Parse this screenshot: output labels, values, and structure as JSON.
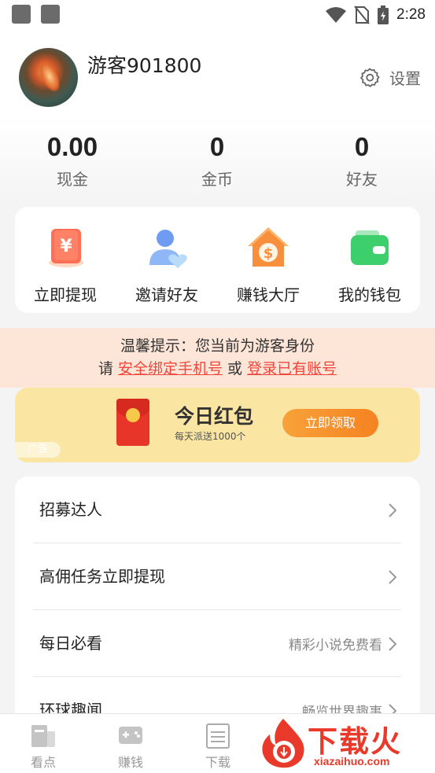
{
  "status_bar": {
    "time": "2:28"
  },
  "profile": {
    "username": "游客901800",
    "settings_label": "设置"
  },
  "stats": [
    {
      "value": "0.00",
      "label": "现金"
    },
    {
      "value": "0",
      "label": "金币"
    },
    {
      "value": "0",
      "label": "好友"
    }
  ],
  "actions": [
    {
      "label": "立即提现",
      "icon": "withdraw-yuan-icon"
    },
    {
      "label": "邀请好友",
      "icon": "invite-friend-icon"
    },
    {
      "label": "赚钱大厅",
      "icon": "money-house-icon"
    },
    {
      "label": "我的钱包",
      "icon": "wallet-icon"
    }
  ],
  "notice": {
    "line1": "温馨提示：您当前为游客身份",
    "prefix": "请",
    "bind_phone": "安全绑定手机号",
    "middle": "或",
    "login": "登录已有账号"
  },
  "ad": {
    "title": "今日红包",
    "subtitle": "每天派送1000个",
    "button": "立即领取",
    "tag": "广告"
  },
  "menu": [
    {
      "label": "招募达人",
      "hint": ""
    },
    {
      "label": "高佣任务立即提现",
      "hint": ""
    },
    {
      "label": "每日必看",
      "hint": "精彩小说免费看"
    },
    {
      "label": "环球趣闻",
      "hint": "畅览世界趣事"
    }
  ],
  "bottom_nav": [
    {
      "label": "看点",
      "icon": "news-icon"
    },
    {
      "label": "赚钱",
      "icon": "gamepad-icon"
    },
    {
      "label": "下载",
      "icon": "document-icon"
    }
  ],
  "watermark": {
    "text": "下载火",
    "url": "xiazaihuo.com"
  },
  "colors": {
    "accent_red": "#f0463c",
    "notice_bg": "#fde6d8",
    "ad_bg": "#fae5a2",
    "ad_button": "#f58220"
  }
}
